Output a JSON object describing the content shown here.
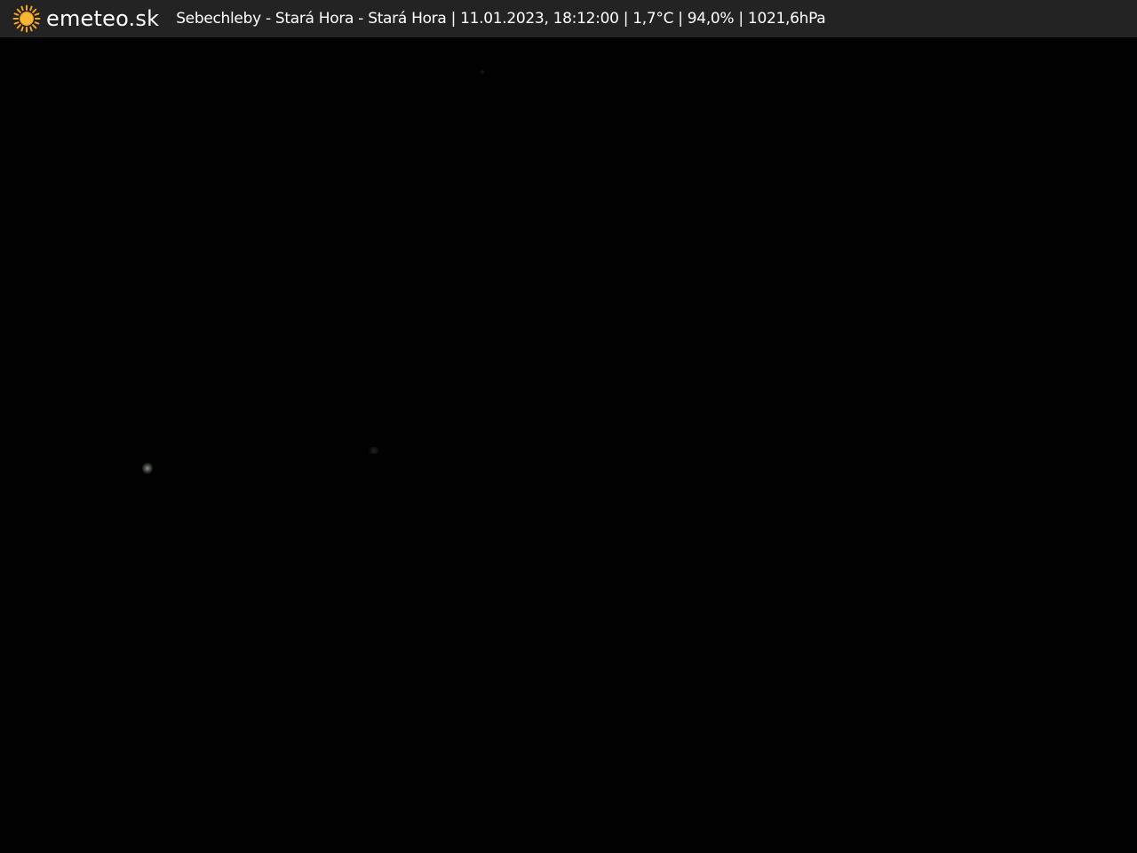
{
  "header": {
    "brand": "emeteo.sk",
    "logo_icon": "sun-icon",
    "logo_color": "#f5a623",
    "caption": "Sebechleby - Stará Hora - Stará Hora | 11.01.2023, 18:12:00 | 1,7°C | 94,0% | 1021,6hPa"
  },
  "colors": {
    "bar_background": "#232323",
    "scene_background": "#010101",
    "text": "#ffffff"
  }
}
